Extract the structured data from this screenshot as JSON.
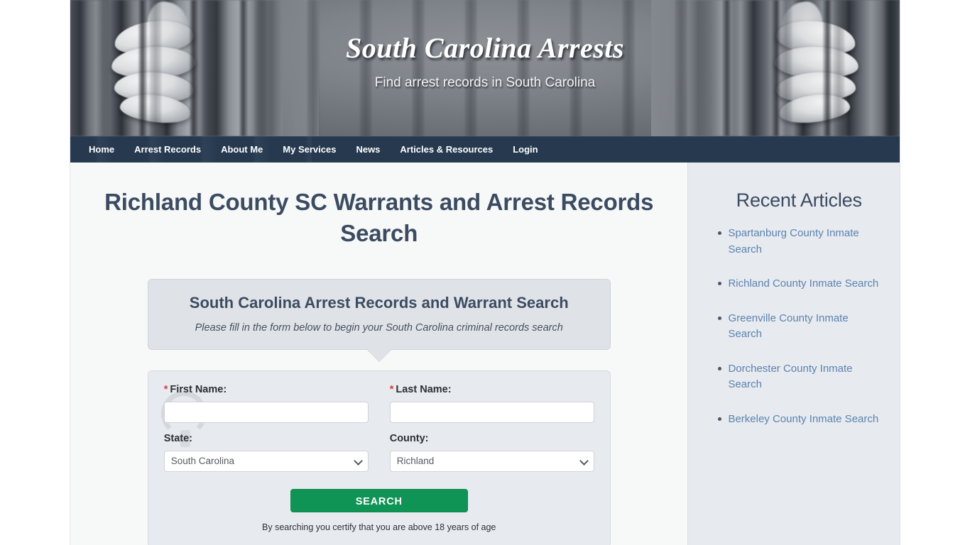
{
  "site": {
    "title": "South Carolina Arrests",
    "tagline": "Find arrest records in South Carolina"
  },
  "nav": {
    "items": [
      {
        "label": "Home"
      },
      {
        "label": "Arrest Records"
      },
      {
        "label": "About Me"
      },
      {
        "label": "My Services"
      },
      {
        "label": "News"
      },
      {
        "label": "Articles & Resources"
      },
      {
        "label": "Login"
      }
    ]
  },
  "main": {
    "page_title": "Richland County SC Warrants and Arrest Records Search",
    "callout": {
      "heading": "South Carolina Arrest Records and Warrant Search",
      "subtext": "Please fill in the form below to begin your South Carolina criminal records search"
    },
    "form": {
      "first_name": {
        "label": "First Name:",
        "required_marker": "*",
        "value": "",
        "placeholder": ""
      },
      "last_name": {
        "label": "Last Name:",
        "required_marker": "*",
        "value": "",
        "placeholder": ""
      },
      "state": {
        "label": "State:",
        "value": "South Carolina"
      },
      "county": {
        "label": "County:",
        "value": "Richland"
      },
      "submit_label": "SEARCH",
      "disclaimer": "By searching you certify that you are above 18 years of age"
    }
  },
  "sidebar": {
    "heading": "Recent Articles",
    "articles": [
      {
        "label": "Spartanburg County Inmate Search"
      },
      {
        "label": "Richland County Inmate Search"
      },
      {
        "label": "Greenville County Inmate Search"
      },
      {
        "label": "Dorchester County Inmate Search"
      },
      {
        "label": "Berkeley County Inmate Search"
      }
    ]
  },
  "colors": {
    "nav_bg": "#26394f",
    "heading": "#3b4b61",
    "link": "#5b83b2",
    "search_button": "#109456",
    "required_marker": "#d43f3a",
    "sidebar_bg": "#e7eaee"
  }
}
